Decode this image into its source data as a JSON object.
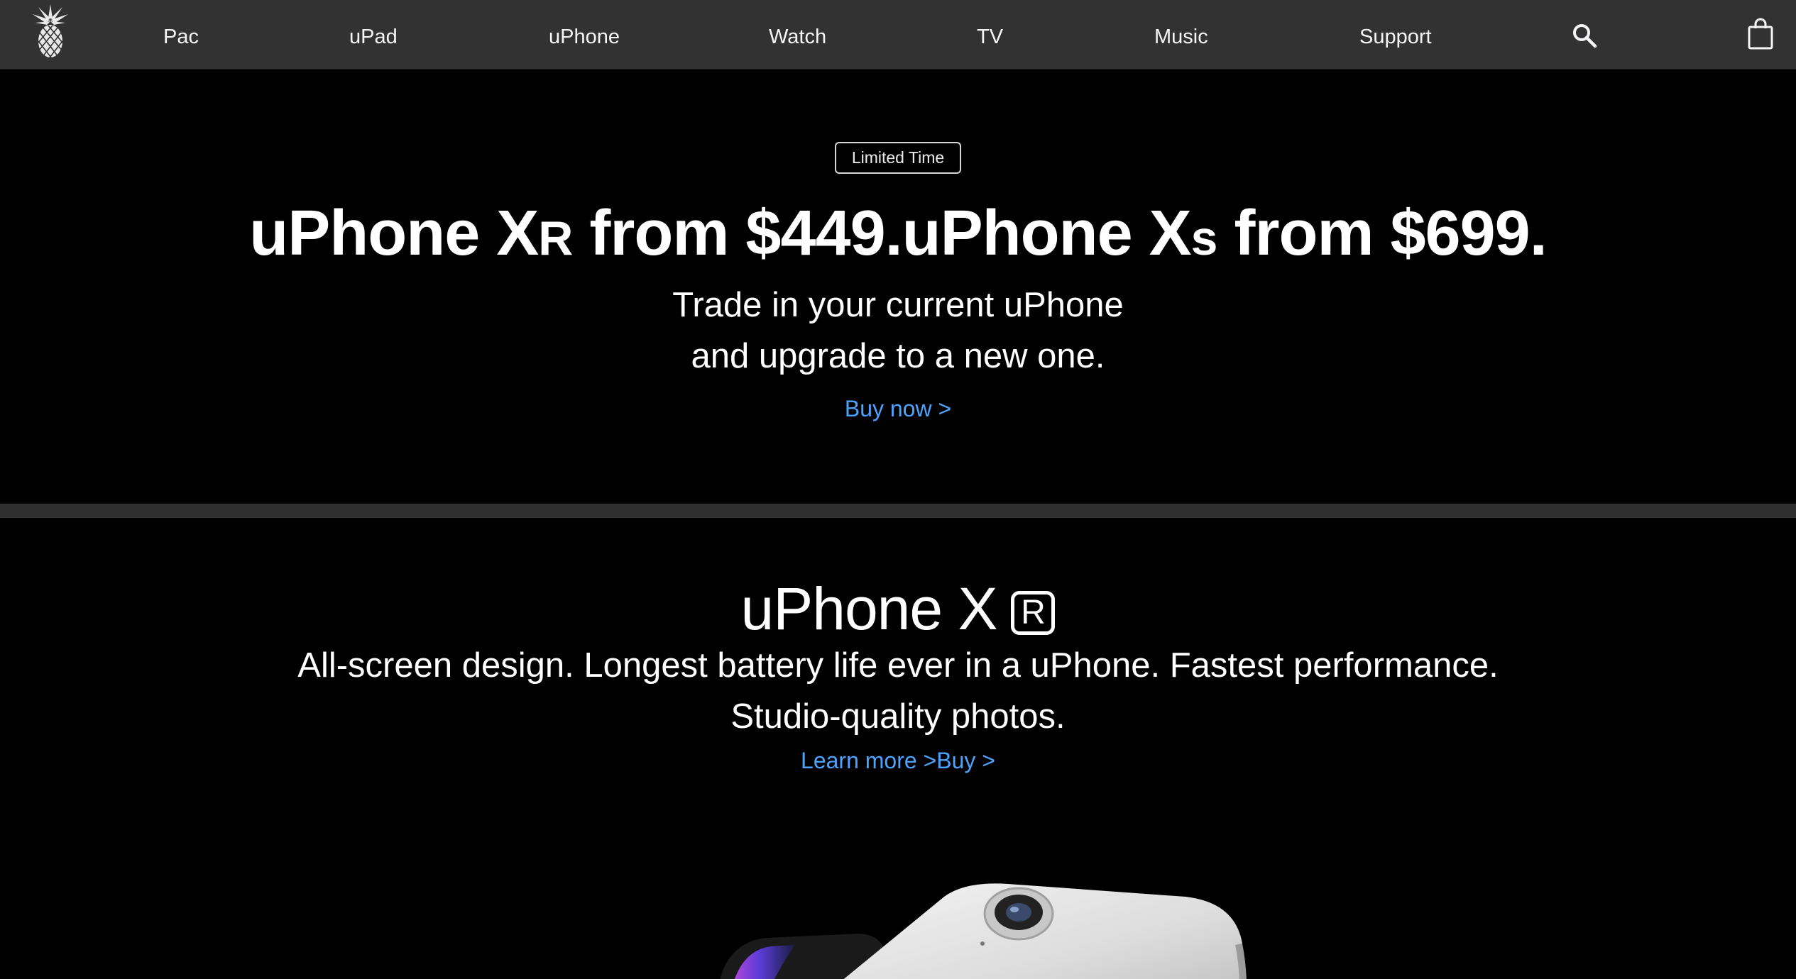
{
  "nav": {
    "logo": "pineapple-logo",
    "items": [
      {
        "label": "Pac"
      },
      {
        "label": "uPad"
      },
      {
        "label": "uPhone"
      },
      {
        "label": "Watch"
      },
      {
        "label": "TV"
      },
      {
        "label": "Music"
      },
      {
        "label": "Support"
      }
    ],
    "icons": [
      "search-icon",
      "bag-icon"
    ]
  },
  "promo": {
    "badge": "Limited Time",
    "headline_a": "uPhone X",
    "headline_a_suffix": "R",
    "headline_b": " from $449.uPhone X",
    "headline_b_suffix": "S",
    "headline_c": " from $699.",
    "sub_line1": "Trade in your current uPhone",
    "sub_line2": "and upgrade to a new one.",
    "cta": "Buy now >"
  },
  "product": {
    "title": "uPhone X",
    "title_mark": "R",
    "description": "All-screen design. Longest battery life ever in a uPhone. Fastest performance. Studio-quality photos.",
    "learn_more": "Learn more >",
    "buy": "Buy >"
  },
  "colors": {
    "nav_bg": "#323232",
    "page_bg": "#000000",
    "link": "#4da3ff",
    "divider": "#2f2f2f"
  }
}
